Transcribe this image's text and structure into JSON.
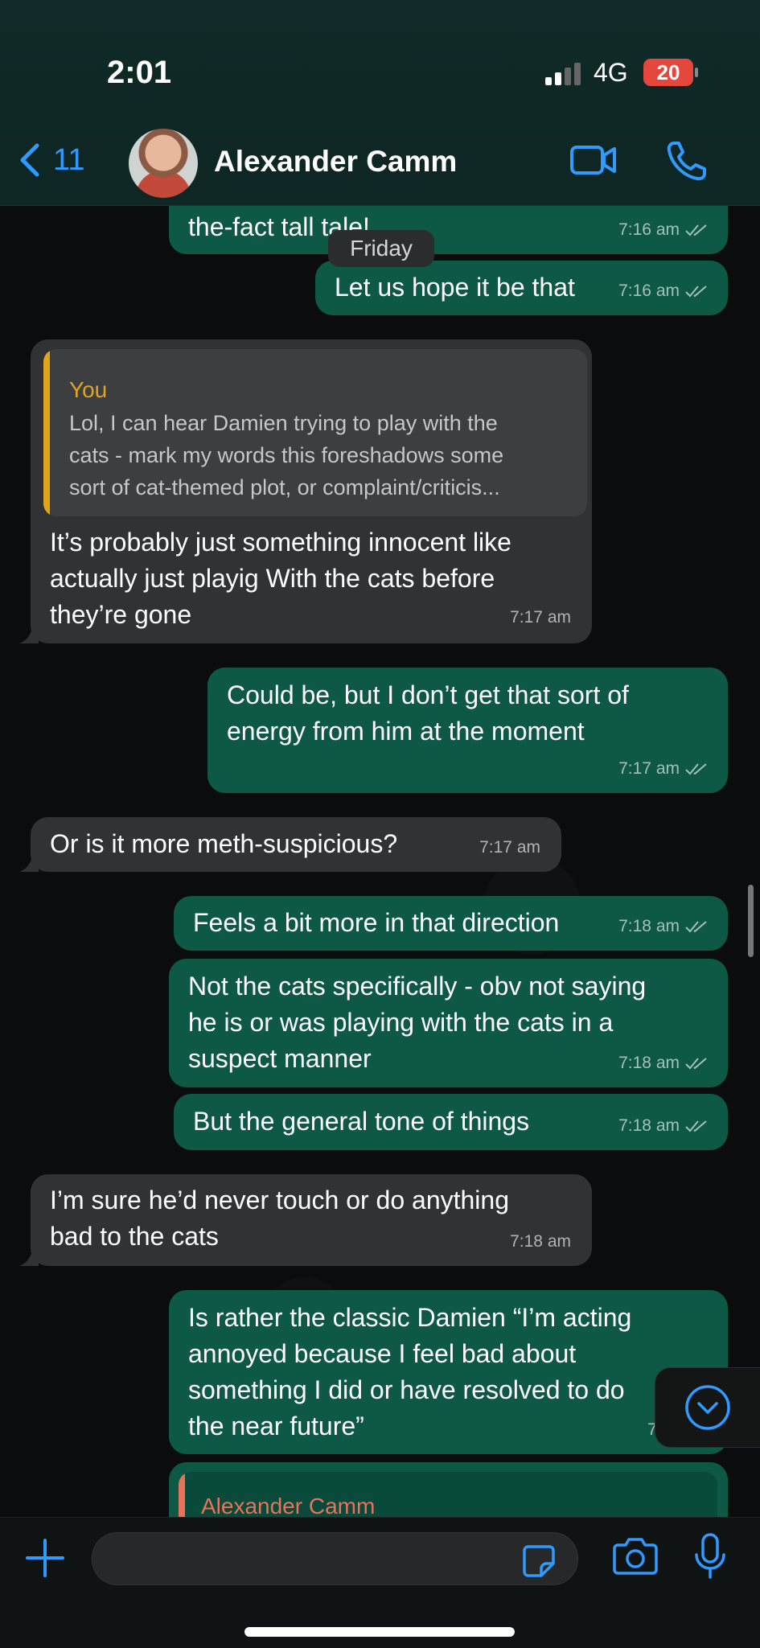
{
  "status_bar": {
    "time": "2:01",
    "network": "4G",
    "battery": "20"
  },
  "header": {
    "back_count": "11",
    "contact_name": "Alexander Camm"
  },
  "date_separator": "Friday",
  "messages": [
    {
      "dir": "out",
      "text": "the-fact tall tale!",
      "time": "7:16 am"
    },
    {
      "dir": "out",
      "text": "Let us hope it be that",
      "time": "7:16 am"
    },
    {
      "dir": "in",
      "quote_author": "You",
      "quote_text": "Lol, I can hear Damien trying to play with the\ncats - mark my words this foreshadows some\nsort of cat-themed plot, or complaint/criticis...",
      "text": "It’s probably just something innocent like\nactually just playig With the cats before\nthey’re gone",
      "time": "7:17 am"
    },
    {
      "dir": "out",
      "text": "Could be, but I don’t get that sort of\nenergy from him at the moment",
      "time": "7:17 am"
    },
    {
      "dir": "in",
      "text": "Or is it more meth-suspicious?",
      "time": "7:17 am"
    },
    {
      "dir": "out",
      "text": "Feels a bit more in that direction",
      "time": "7:18 am"
    },
    {
      "dir": "out",
      "text": "Not the cats specifically - obv not saying\nhe is or was playing with the cats in a\nsuspect manner",
      "time": "7:18 am"
    },
    {
      "dir": "out",
      "text": "But the general tone of things",
      "time": "7:18 am"
    },
    {
      "dir": "in",
      "text": "I’m sure he’d never touch or do anything\nbad to the cats",
      "time": "7:18 am"
    },
    {
      "dir": "out",
      "text": "Is rather the classic Damien “I’m acting\nannoyed because I feel bad about\nsomething I did or have resolved to do\nthe near future”",
      "time": "7:19 am"
    },
    {
      "dir": "out",
      "quote_author": "Alexander Camm"
    }
  ],
  "colors": {
    "outgoing": "#0e5846",
    "incoming": "#303234",
    "accent": "#2f9bff",
    "quote_you": "#e2a41d",
    "quote_other": "#e8735a"
  },
  "icons": [
    "chevron-left-icon",
    "video-call-icon",
    "phone-icon",
    "plus-icon",
    "sticker-icon",
    "camera-icon",
    "mic-icon",
    "chevron-down-circle-icon"
  ]
}
